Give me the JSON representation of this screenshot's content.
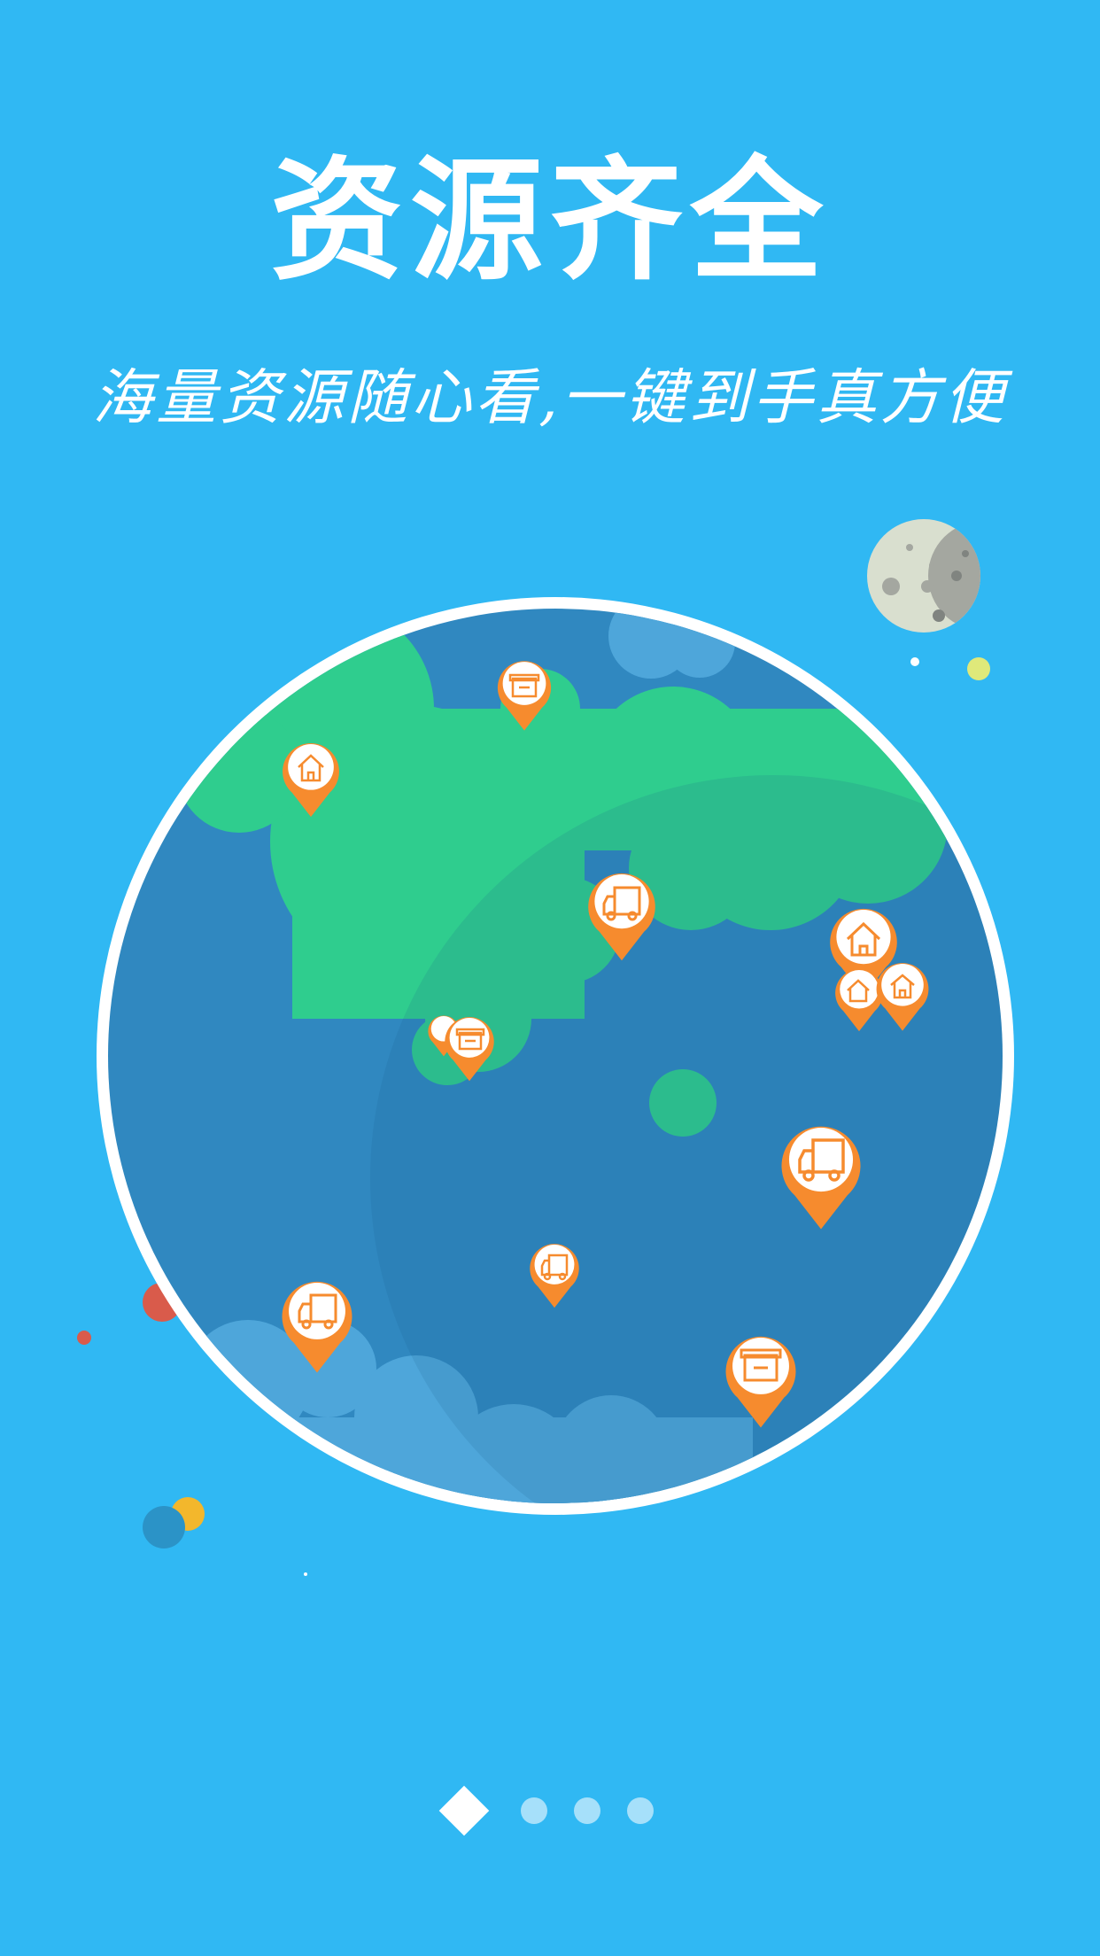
{
  "screen": {
    "title": "资源齐全",
    "subtitle": "海量资源随心看,一键到手真方便"
  },
  "colors": {
    "background": "#30b8f3",
    "ocean": "#3088c0",
    "land": "#2fcd8e",
    "pin": "#f68b2e",
    "globe_rim": "#ffffff",
    "moon": "#d9dfcf"
  },
  "icons": [
    "house-icon",
    "box-icon",
    "truck-icon",
    "moon-icon"
  ],
  "pagination": {
    "total": 4,
    "active_index": 0
  }
}
